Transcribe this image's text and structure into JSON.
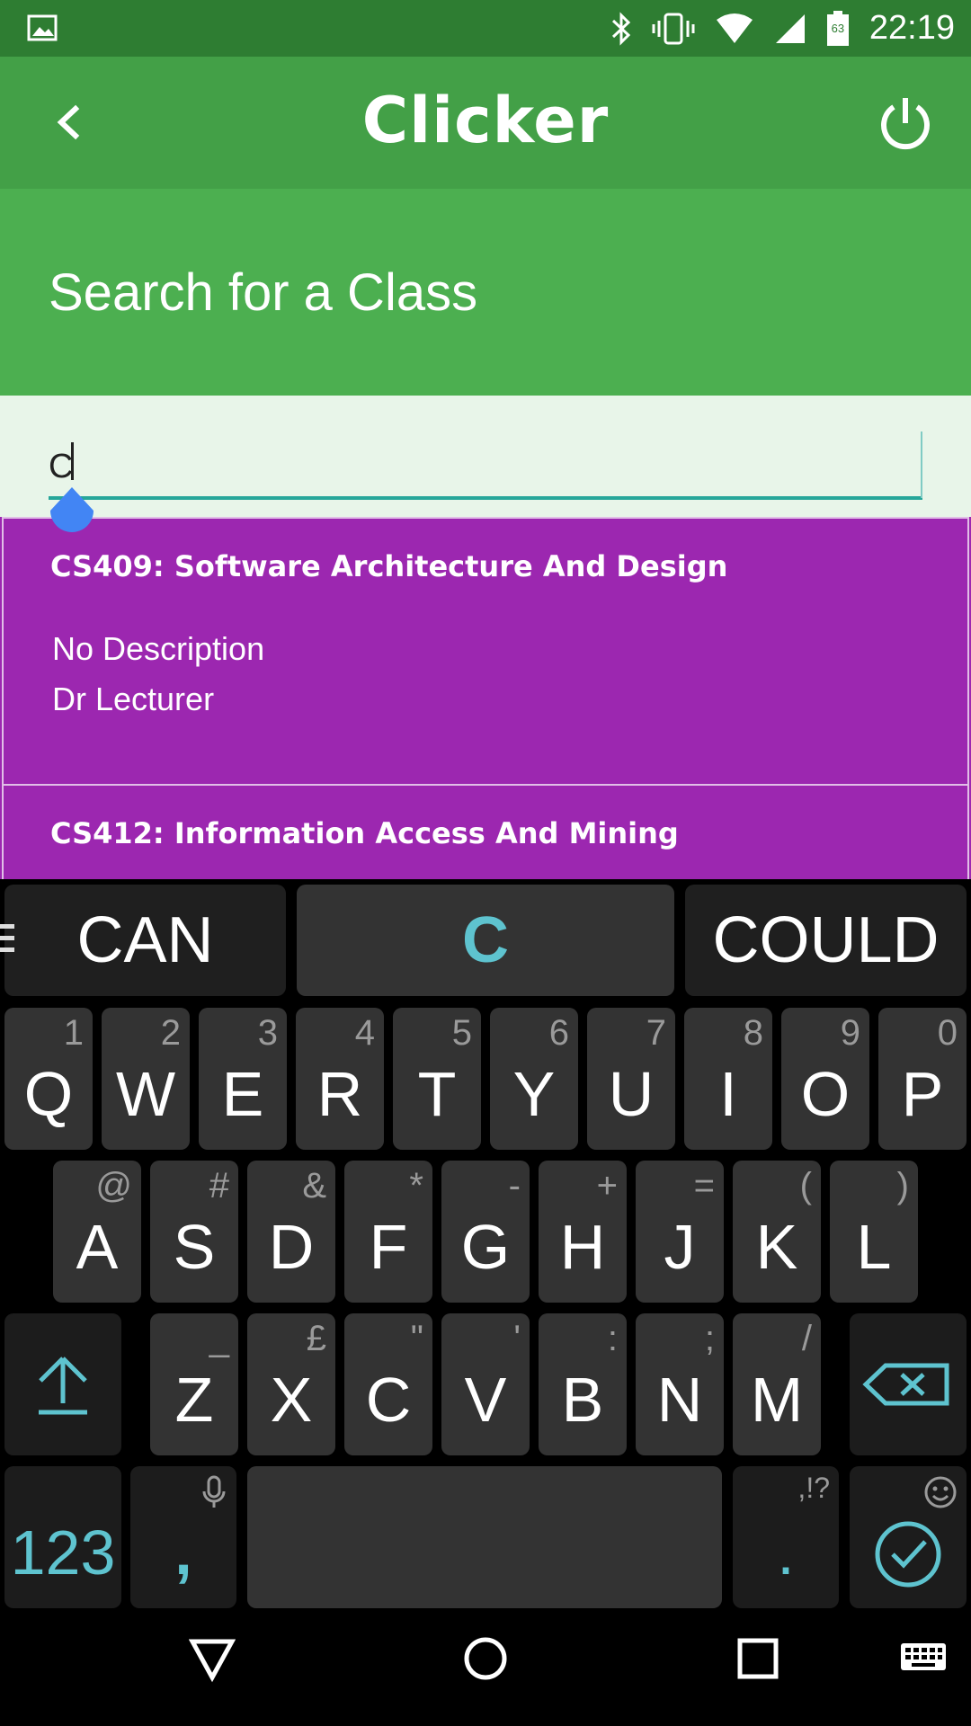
{
  "status_bar": {
    "time": "22:19",
    "battery_level": "63",
    "icons": [
      "image-icon",
      "bluetooth-icon",
      "vibrate-icon",
      "wifi-icon",
      "cell-signal-icon",
      "battery-icon"
    ]
  },
  "app_bar": {
    "title": "Clicker",
    "back_icon": "back-arrow-icon",
    "power_icon": "power-icon"
  },
  "heading": "Search for a Class",
  "search": {
    "value": "C",
    "placeholder": ""
  },
  "results": [
    {
      "title": "CS409: Software Architecture And Design",
      "description": "No Description",
      "lecturer": "Dr Lecturer"
    },
    {
      "title": "CS412: Information Access And Mining"
    }
  ],
  "keyboard": {
    "suggestions": [
      "CAN",
      "C",
      "COULD"
    ],
    "row1": [
      {
        "key": "Q",
        "hint": "1"
      },
      {
        "key": "W",
        "hint": "2"
      },
      {
        "key": "E",
        "hint": "3"
      },
      {
        "key": "R",
        "hint": "4"
      },
      {
        "key": "T",
        "hint": "5"
      },
      {
        "key": "Y",
        "hint": "6"
      },
      {
        "key": "U",
        "hint": "7"
      },
      {
        "key": "I",
        "hint": "8"
      },
      {
        "key": "O",
        "hint": "9"
      },
      {
        "key": "P",
        "hint": "0"
      }
    ],
    "row2": [
      {
        "key": "A",
        "hint": "@"
      },
      {
        "key": "S",
        "hint": "#"
      },
      {
        "key": "D",
        "hint": "&"
      },
      {
        "key": "F",
        "hint": "*"
      },
      {
        "key": "G",
        "hint": "-"
      },
      {
        "key": "H",
        "hint": "+"
      },
      {
        "key": "J",
        "hint": "="
      },
      {
        "key": "K",
        "hint": "("
      },
      {
        "key": "L",
        "hint": ")"
      }
    ],
    "row3": [
      {
        "key": "Z",
        "hint": "_"
      },
      {
        "key": "X",
        "hint": "£"
      },
      {
        "key": "C",
        "hint": "\""
      },
      {
        "key": "V",
        "hint": "'"
      },
      {
        "key": "B",
        "hint": ":"
      },
      {
        "key": "N",
        "hint": ";"
      },
      {
        "key": "M",
        "hint": "/"
      }
    ],
    "numbers_key": "123",
    "comma_key": ",",
    "period_key": ".",
    "period_hint": ",!?",
    "accent_color": "#5ec3cf"
  },
  "colors": {
    "status_bar": "#2e7d32",
    "app_bar": "#43a047",
    "heading_bg": "#4caf50",
    "search_bg": "#e8f5e9",
    "card_bg": "#9c27b0",
    "underline": "#26a69a"
  }
}
